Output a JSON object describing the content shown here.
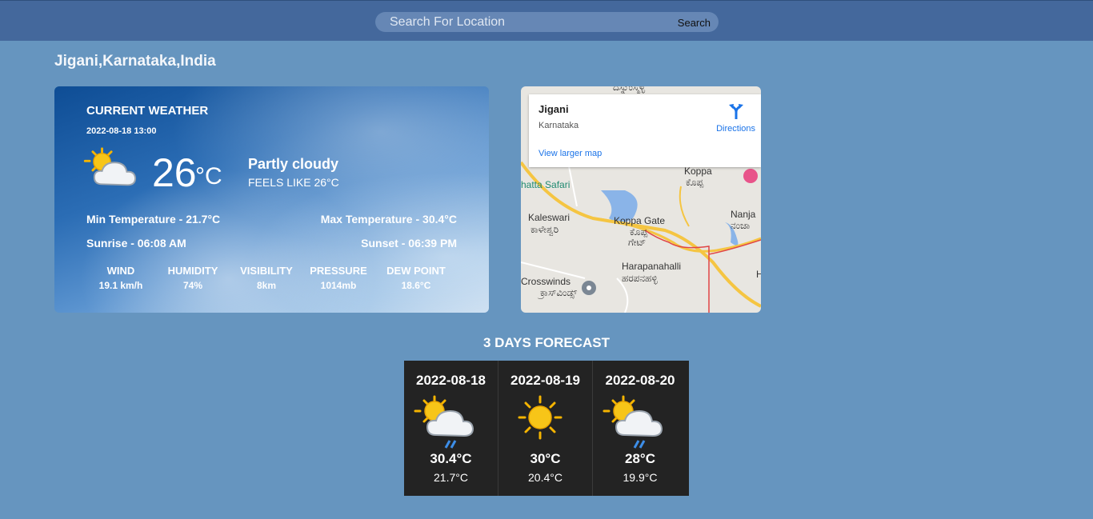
{
  "search": {
    "placeholder": "Search For Location",
    "button_label": "Search"
  },
  "location": "Jigani,Karnataka,India",
  "current": {
    "title": "CURRENT WEATHER",
    "datetime": "2022-08-18 13:00",
    "icon": "partly-cloudy-icon",
    "temp": "26",
    "unit": "°C",
    "condition": "Partly cloudy",
    "feels_like": "FEELS LIKE 26°C",
    "min_temp": "Min Temperature - 21.7°C",
    "max_temp": "Max Temperature - 30.4°C",
    "sunrise": "Sunrise - 06:08 AM",
    "sunset": "Sunset - 06:39 PM",
    "stats": [
      {
        "label": "WIND",
        "value": "19.1 km/h"
      },
      {
        "label": "HUMIDITY",
        "value": "74%"
      },
      {
        "label": "VISIBILITY",
        "value": "8km"
      },
      {
        "label": "PRESSURE",
        "value": "1014mb"
      },
      {
        "label": "DEW POINT",
        "value": "18.6°C"
      }
    ]
  },
  "map": {
    "place_name": "Jigani",
    "state": "Karnataka",
    "directions_label": "Directions",
    "larger_map_label": "View larger map",
    "labels": [
      "Koppa",
      "ಕೊಪ್ಪ",
      "hatta Safari",
      "Kaleswari",
      "ಕಾಳೇಶ್ವರಿ",
      "Koppa Gate",
      "ಕೊಪ್ಪ",
      "ಗೇಟ್",
      "Nanja",
      "ನಂಜಾ",
      "Harapanahalli",
      "ಹರಪನಹಳ್ಳಿ",
      "Crosswinds",
      "ಕ್ರಾಸ್‌ವಿಂಡ್ಸ್",
      "ದಸ್ನುಂಸ್ಮಳ್ಳಿ",
      "H"
    ],
    "colors": {
      "road": "#f5c542",
      "border": "#e04545",
      "water": "#8ab4e8",
      "link": "#1a73e8"
    }
  },
  "forecast": {
    "title": "3 DAYS FORECAST",
    "days": [
      {
        "date": "2022-08-18",
        "icon": "partly-cloudy-rain-icon",
        "max": "30.4°C",
        "min": "21.7°C"
      },
      {
        "date": "2022-08-19",
        "icon": "sunny-icon",
        "max": "30°C",
        "min": "20.4°C"
      },
      {
        "date": "2022-08-20",
        "icon": "partly-cloudy-rain-icon",
        "max": "28°C",
        "min": "19.9°C"
      }
    ]
  }
}
